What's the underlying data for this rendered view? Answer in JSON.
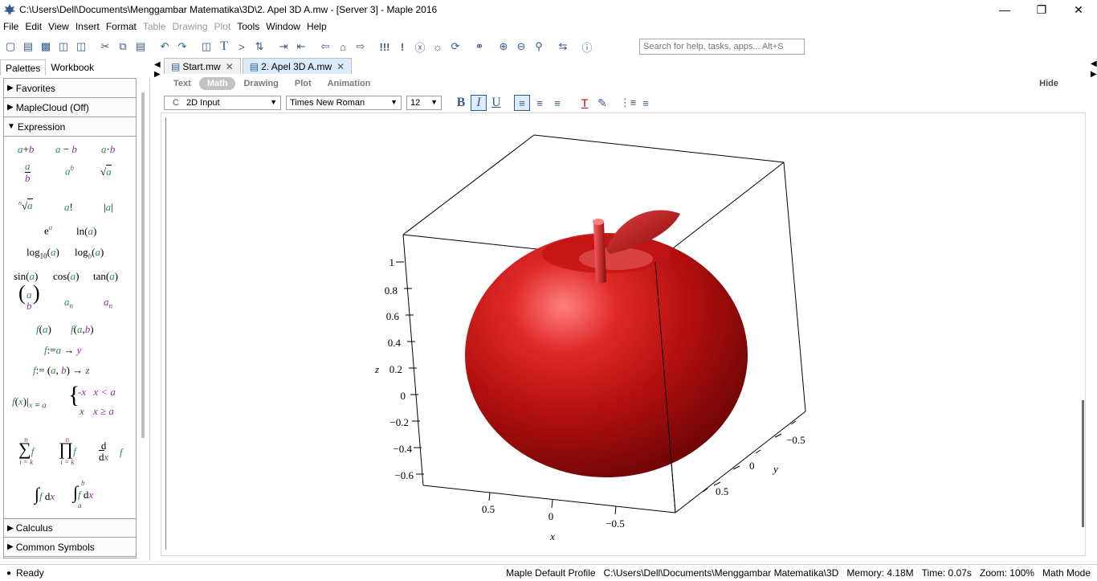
{
  "window": {
    "title": "C:\\Users\\Dell\\Documents\\Menggambar Matematika\\3D\\2. Apel 3D A.mw - [Server 3] - Maple 2016"
  },
  "menu": {
    "items": [
      "File",
      "Edit",
      "View",
      "Insert",
      "Format",
      "Table",
      "Drawing",
      "Plot",
      "Tools",
      "Window",
      "Help"
    ],
    "disabled": [
      "Table",
      "Drawing",
      "Plot"
    ]
  },
  "search": {
    "placeholder": "Search for help, tasks, apps... Alt+S"
  },
  "palette": {
    "tabs": [
      "Palettes",
      "Workbook"
    ],
    "sections_top": [
      "Favorites",
      "MapleCloud (Off)",
      "Expression"
    ],
    "sections_bottom": [
      "Calculus",
      "Common Symbols"
    ]
  },
  "documents": {
    "tabs": [
      {
        "label": "Start.mw"
      },
      {
        "label": "2. Apel 3D A.mw"
      }
    ]
  },
  "context_bar": {
    "modes": [
      "Text",
      "Math",
      "Drawing",
      "Plot",
      "Animation"
    ],
    "active": "Math",
    "hide": "Hide"
  },
  "format_bar": {
    "input_mode": "2D Input",
    "input_prefix": "C",
    "font": "Times New Roman",
    "size": "12"
  },
  "plot": {
    "axis_x_label": "x",
    "axis_y_label": "y",
    "axis_z_label": "z",
    "z_ticks": [
      "1",
      "0.8",
      "0.6",
      "0.4",
      "0.2",
      "0",
      "−0.2",
      "−0.4",
      "−0.6"
    ],
    "x_ticks": [
      "0.5",
      "0",
      "−0.5"
    ],
    "y_ticks": [
      "−0.5",
      "0",
      "0.5"
    ],
    "surface_color": "#c01414"
  },
  "status": {
    "ready": "Ready",
    "profile": "Maple Default Profile",
    "path": "C:\\Users\\Dell\\Documents\\Menggambar Matematika\\3D",
    "memory": "Memory: 4.18M",
    "time": "Time: 0.07s",
    "zoom": "Zoom: 100%",
    "mode": "Math Mode"
  }
}
